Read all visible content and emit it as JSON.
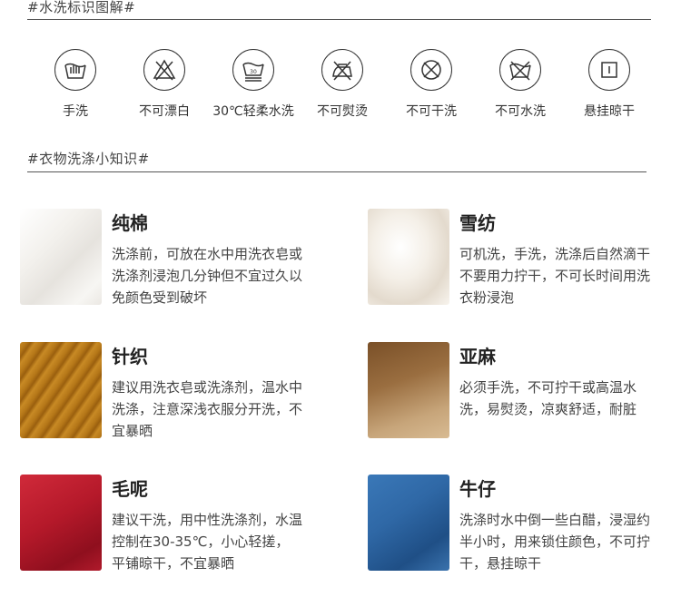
{
  "wash_section": {
    "title": "#水洗标识图解#"
  },
  "care_symbols": [
    {
      "label": "手洗",
      "icon": "hand-wash-icon"
    },
    {
      "label": "不可漂白",
      "icon": "no-bleach-icon"
    },
    {
      "label": "30℃轻柔水洗",
      "icon": "gentle-wash-30-icon",
      "temp": "30"
    },
    {
      "label": "不可熨烫",
      "icon": "no-iron-icon"
    },
    {
      "label": "不可干洗",
      "icon": "no-dry-clean-icon"
    },
    {
      "label": "不可水洗",
      "icon": "no-wash-icon"
    },
    {
      "label": "悬挂晾干",
      "icon": "line-dry-icon"
    }
  ],
  "knowledge_section": {
    "title": "#衣物洗涤小知识#"
  },
  "fabrics": [
    {
      "name": "纯棉",
      "desc": "洗涤前，可放在水中用洗衣皂或洗涤剂浸泡几分钟但不宜过久以免颜色受到破坏",
      "color": "#f2f0ec"
    },
    {
      "name": "雪纺",
      "desc": "可机洗，手洗，洗涤后自然滴干不要用力拧干，不可长时间用洗衣粉浸泡",
      "color": "#f1ece4"
    },
    {
      "name": "针织",
      "desc": "建议用洗衣皂或洗涤剂，温水中洗涤，注意深浅衣服分开洗，不宜暴晒",
      "color": "#b57a1c"
    },
    {
      "name": "亚麻",
      "desc": "必须手洗，不可拧干或高温水洗，易熨烫，凉爽舒适，耐脏",
      "color": "#a1784e"
    },
    {
      "name": "毛呢",
      "desc": "建议干洗，用中性洗涤剂，水温控制在30-35℃，小心轻搓，平铺晾干，不宜暴晒",
      "color": "#b5192a"
    },
    {
      "name": "牛仔",
      "desc": "洗涤时水中倒一些白醋，浸湿约半小时，用来锁住颜色，不可拧干，悬挂晾干",
      "color": "#2f68a6"
    }
  ]
}
